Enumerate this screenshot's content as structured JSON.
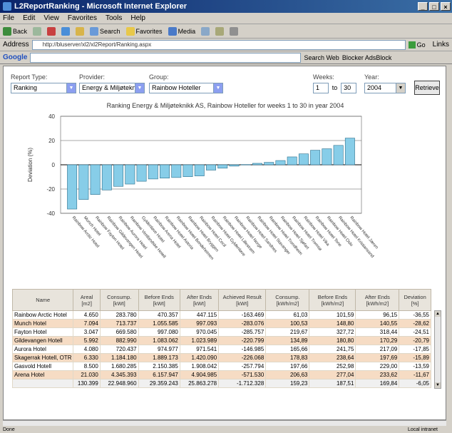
{
  "window": {
    "title": "L2ReportRanking - Microsoft Internet Explorer",
    "buttons": [
      "_",
      "□",
      "×"
    ]
  },
  "menu": [
    "File",
    "Edit",
    "View",
    "Favorites",
    "Tools",
    "Help"
  ],
  "toolbar": {
    "back": "Back",
    "search": "Search",
    "favorites": "Favorites",
    "media": "Media"
  },
  "address": {
    "label": "Address",
    "url": "http://bluserver/xl2/xl2Report/Ranking.aspx",
    "go": "Go",
    "links": "Links"
  },
  "googlebar": {
    "label": "Google",
    "search_web": "Search Web",
    "blocker": "Blocker AdsBlock"
  },
  "form": {
    "report_type_label": "Report Type:",
    "report_type_value": "Ranking",
    "provider_label": "Provider:",
    "provider_value": "Energy & Miljøteknikk",
    "group_label": "Group:",
    "group_value": "Rainbow Hoteller",
    "weeks_label": "Weeks:",
    "week_from": "1",
    "week_to_label": "to",
    "week_to": "30",
    "year_label": "Year:",
    "year_value": "2004",
    "retrieve": "Retrieve"
  },
  "chart_data": {
    "type": "bar",
    "title": "Ranking Energy & Miljøteknikk AS, Rainbow Hoteller for weeks 1 to 30 in year 2004",
    "ylabel": "Deviation (%)",
    "ylim": [
      -40,
      40
    ],
    "yticks": [
      40,
      20,
      0,
      -20,
      -40
    ],
    "color": "#87cde8",
    "categories": [
      "Rainbow Arctic Hotel",
      "Munch Hotel",
      "Rainbow Fayton Hotel",
      "Rainbow Gildevangen Hotel",
      "Rainbow Aurora Hotel",
      "Rainbow Vestlandske Hotell",
      "Gyldenløve Hotel",
      "Rainbow Arena Hotel",
      "Rainbow Hotel Astoria",
      "Rainbow Hotel Bondeheimen",
      "Rainbow Hotel Bryggen",
      "Rainbow Hotel Cecil",
      "Rainbow Hotel Gyldenløve",
      "Rainbow Hotel Lillestrøm",
      "Rainbow Hotel Norge",
      "Rainbow Hotel Sandnes",
      "Rainbow Hotel Stavanger",
      "Rainbow Hotel Trondheim",
      "Rainbow Hotel Sjøfart",
      "Rainbow Hotel Tromsø",
      "Rainbow Hotel Vika",
      "Rainbow Hotel Tone",
      "Rainbow Hotel Oslo",
      "Rainbow Hotel Kristiansand",
      "Rainbow Hotel Jæren"
    ],
    "values": [
      -36.5,
      -28.6,
      -24.5,
      -20.8,
      -17.8,
      -15.9,
      -13.6,
      -11.7,
      -11.0,
      -10.5,
      -9.8,
      -9.2,
      -4.4,
      -2.8,
      -1.1,
      0.2,
      1.2,
      2.0,
      3.5,
      6.5,
      9.0,
      12.0,
      13.2,
      16.0,
      22.0
    ]
  },
  "table": {
    "headers": [
      "Name",
      "Areal [m2]",
      "Consump. [kWt]",
      "Before Ends [kWt]",
      "After Ends [kWt]",
      "Achieved Result [kWt]",
      "Consump. [kWh/m2]",
      "Before Ends [kWh/m2]",
      "After Ends [kWh/m2]",
      "Deviation [%]"
    ],
    "rows": [
      [
        "Rainbow Arctic Hotel",
        "4.650",
        "283.780",
        "470.357",
        "447.115",
        "-163.469",
        "61,03",
        "101,59",
        "96,15",
        "-36,55"
      ],
      [
        "Munch Hotel",
        "7.094",
        "713.737",
        "1.055.585",
        "997.093",
        "-283.076",
        "100,53",
        "148,80",
        "140,55",
        "-28,62"
      ],
      [
        "Fayton Hotel",
        "3.047",
        "669.580",
        "997.080",
        "970.045",
        "-285.757",
        "219,67",
        "327,72",
        "318,44",
        "-24,51"
      ],
      [
        "Gildevangen Hotell",
        "5.992",
        "882.990",
        "1.083.062",
        "1.023.989",
        "-220.799",
        "134,89",
        "180,80",
        "170,29",
        "-20,79"
      ],
      [
        "Aurora Hotel",
        "4.080",
        "720.437",
        "974.977",
        "971.541",
        "-146.985",
        "165,66",
        "241,75",
        "217,09",
        "-17,85"
      ],
      [
        "Skagerrak Hotell, OTR",
        "6.330",
        "1.184.180",
        "1.889.173",
        "1.420.090",
        "-226.068",
        "178,83",
        "238,64",
        "197,69",
        "-15,89"
      ],
      [
        "Gasvold Hotell",
        "8.500",
        "1.680.285",
        "2.150.385",
        "1.908.042",
        "-257.794",
        "197,66",
        "252,98",
        "229,00",
        "-13,59"
      ],
      [
        "Arena Hotel",
        "21.030",
        "4.345.393",
        "6.157.947",
        "4.904.985",
        "-571.530",
        "206,63",
        "277,04",
        "233,62",
        "-11,67"
      ]
    ],
    "totals": [
      "",
      "130.399",
      "22.948.960",
      "29.359.243",
      "25.863.278",
      "-1.712.328",
      "159,23",
      "187,51",
      "169,84",
      "-6,05"
    ]
  },
  "status": {
    "left": "Done",
    "zone": "Local intranet"
  }
}
